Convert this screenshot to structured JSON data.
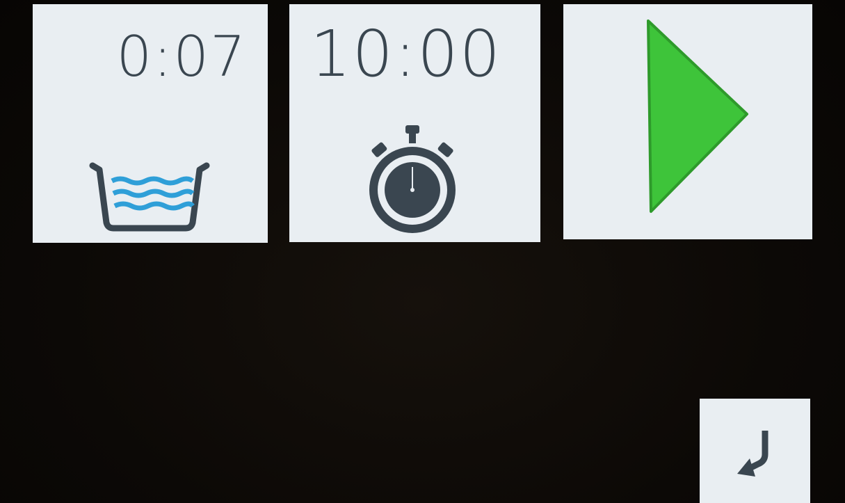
{
  "water_tile": {
    "time": "0:07",
    "icon": "water-basin-icon"
  },
  "timer_tile": {
    "time": "10:00",
    "icon": "stopwatch-icon"
  },
  "start_tile": {
    "icon": "play-icon"
  },
  "back_tile": {
    "icon": "return-arrow-icon"
  },
  "colors": {
    "tile_background": "#e9eef2",
    "text": "#3a4650",
    "water": "#2f9fd8",
    "play": "#3ec43a",
    "screen_background": "#0d0a07"
  }
}
